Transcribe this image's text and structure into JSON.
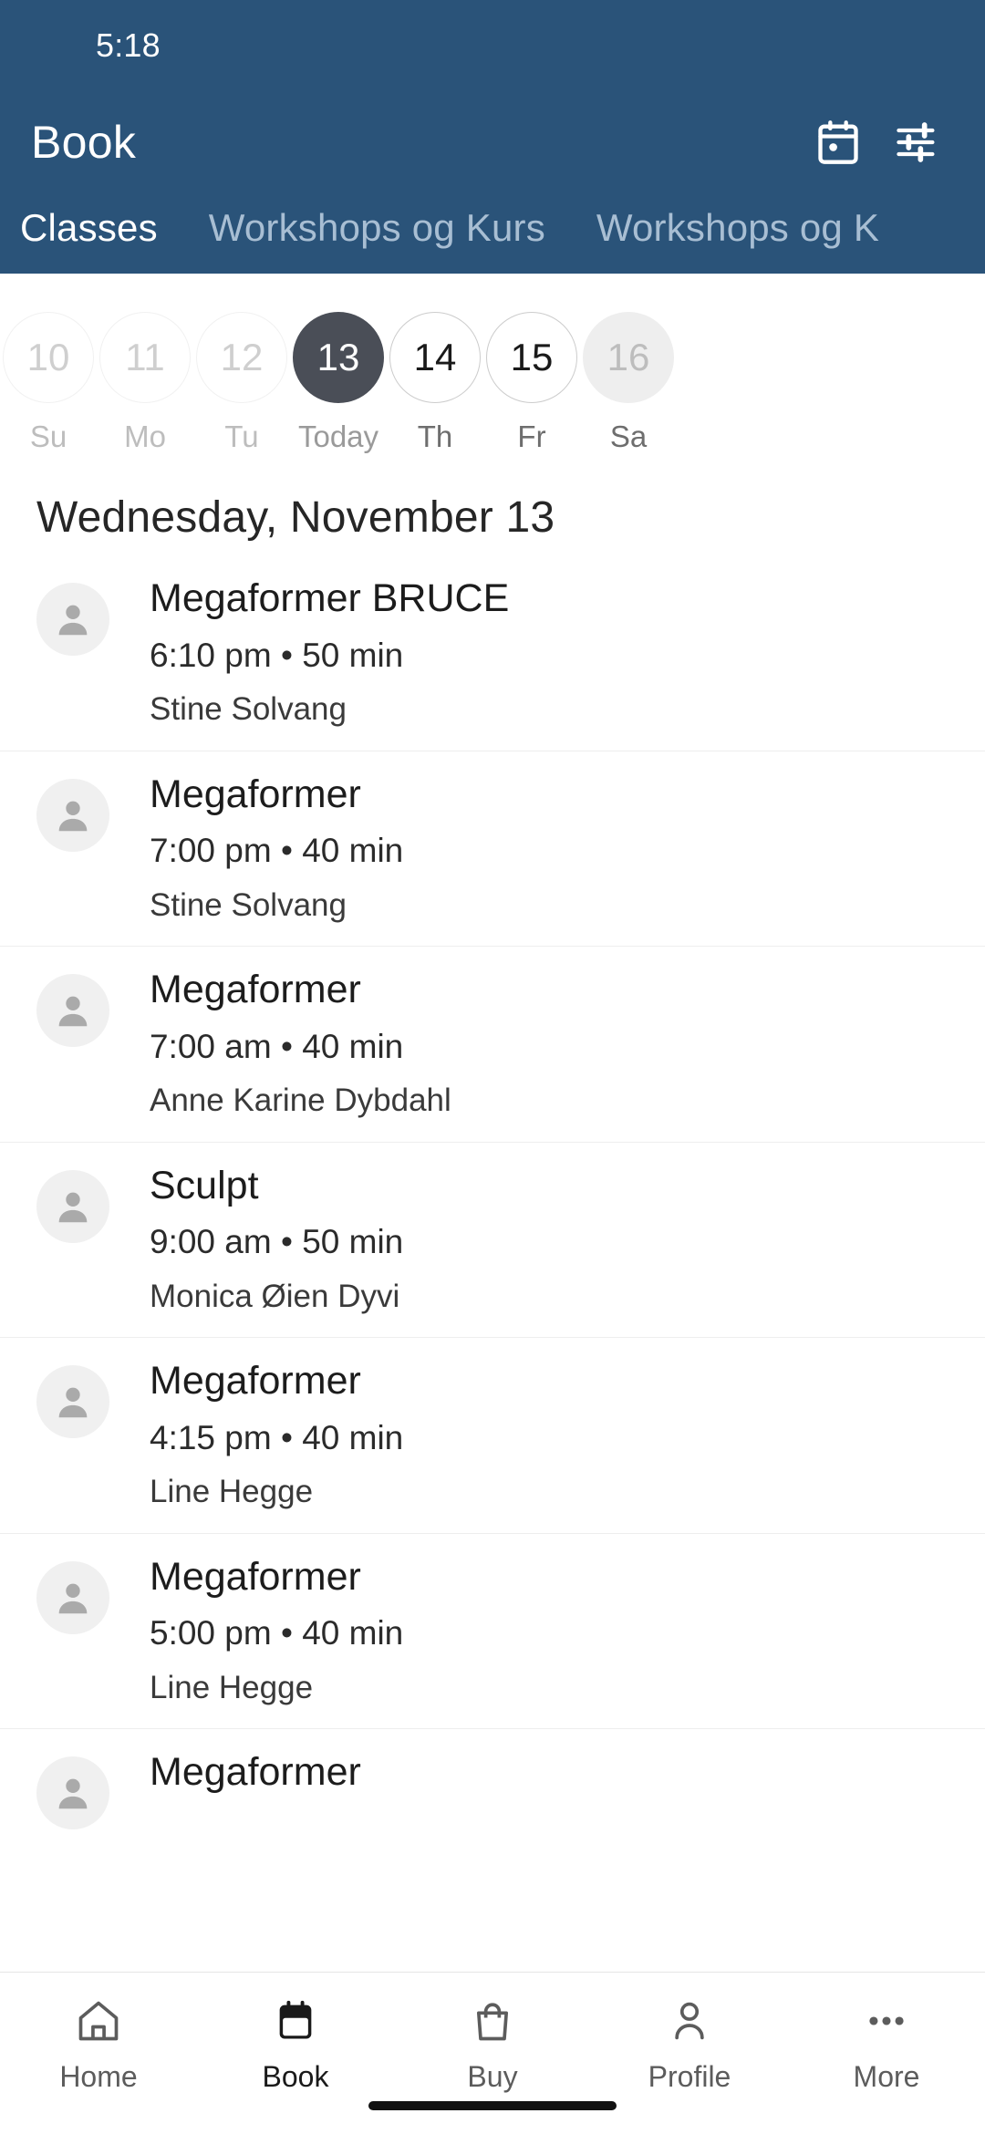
{
  "statusbar": {
    "time": "5:18"
  },
  "header": {
    "title": "Book",
    "accent_color": "#2a5379",
    "calendar_icon": "calendar-event-icon",
    "filter_icon": "filter-sliders-icon",
    "tabs": [
      {
        "label": "Classes",
        "active": true
      },
      {
        "label": "Workshops og Kurs",
        "active": false
      },
      {
        "label": "Workshops og K",
        "active": false
      }
    ]
  },
  "datestrip": {
    "days": [
      {
        "num": "10",
        "weekday": "Su",
        "state": "past"
      },
      {
        "num": "11",
        "weekday": "Mo",
        "state": "past"
      },
      {
        "num": "12",
        "weekday": "Tu",
        "state": "past"
      },
      {
        "num": "13",
        "weekday": "Today",
        "state": "selected"
      },
      {
        "num": "14",
        "weekday": "Th",
        "state": "normal"
      },
      {
        "num": "15",
        "weekday": "Fr",
        "state": "normal"
      },
      {
        "num": "16",
        "weekday": "Sa",
        "state": "muted-fill"
      }
    ],
    "selected_color": "#4a4e57"
  },
  "schedule": {
    "day_title": "Wednesday, November 13",
    "classes": [
      {
        "name": "Megaformer BRUCE",
        "meta": "6:10 pm • 50 min",
        "teacher": "Stine Solvang"
      },
      {
        "name": "Megaformer",
        "meta": "7:00 pm • 40 min",
        "teacher": "Stine Solvang"
      },
      {
        "name": "Megaformer",
        "meta": "7:00 am • 40 min",
        "teacher": "Anne Karine Dybdahl"
      },
      {
        "name": "Sculpt",
        "meta": "9:00 am • 50 min",
        "teacher": "Monica Øien Dyvi"
      },
      {
        "name": "Megaformer",
        "meta": "4:15 pm • 40 min",
        "teacher": "Line Hegge"
      },
      {
        "name": "Megaformer",
        "meta": "5:00 pm • 40 min",
        "teacher": "Line Hegge"
      },
      {
        "name": "Megaformer",
        "meta": "",
        "teacher": ""
      }
    ]
  },
  "bottomnav": {
    "items": [
      {
        "label": "Home",
        "icon": "home-icon",
        "active": false
      },
      {
        "label": "Book",
        "icon": "calendar-icon",
        "active": true
      },
      {
        "label": "Buy",
        "icon": "shopping-bag-icon",
        "active": false
      },
      {
        "label": "Profile",
        "icon": "person-icon",
        "active": false
      },
      {
        "label": "More",
        "icon": "ellipsis-icon",
        "active": false
      }
    ]
  }
}
